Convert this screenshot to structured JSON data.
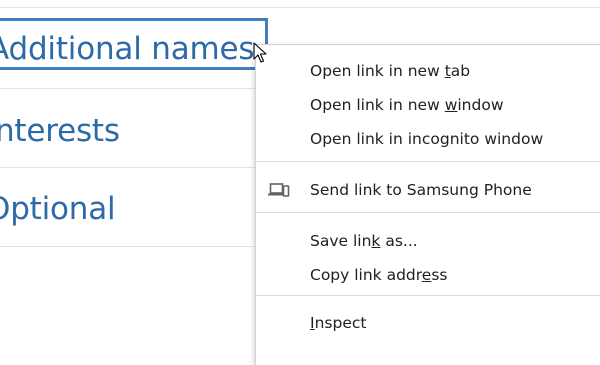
{
  "page": {
    "links": [
      {
        "prefix": "Additional name",
        "suffix": "s"
      },
      {
        "prefix": "Interests",
        "suffix": ""
      },
      {
        "prefix": "Optional",
        "suffix": ""
      }
    ]
  },
  "context_menu": {
    "items": [
      {
        "before": "Open link in new ",
        "key": "t",
        "after": "ab"
      },
      {
        "before": "Open link in new ",
        "key": "w",
        "after": "indow"
      },
      {
        "before": "Open link in inco",
        "key": "g",
        "after": "nito window"
      },
      {
        "before": "Send link to Samsung Phone",
        "key": "",
        "after": "",
        "icon": "device-send-icon"
      },
      {
        "before": "Save lin",
        "key": "k",
        "after": " as..."
      },
      {
        "before": "Copy link addr",
        "key": "e",
        "after": "ss"
      },
      {
        "before": "",
        "key": "I",
        "after": "nspect"
      }
    ]
  },
  "colors": {
    "link": "#2c6aa8",
    "focus_ring": "#3f7fbe",
    "menu_text": "#202124",
    "separator": "#dedede"
  }
}
